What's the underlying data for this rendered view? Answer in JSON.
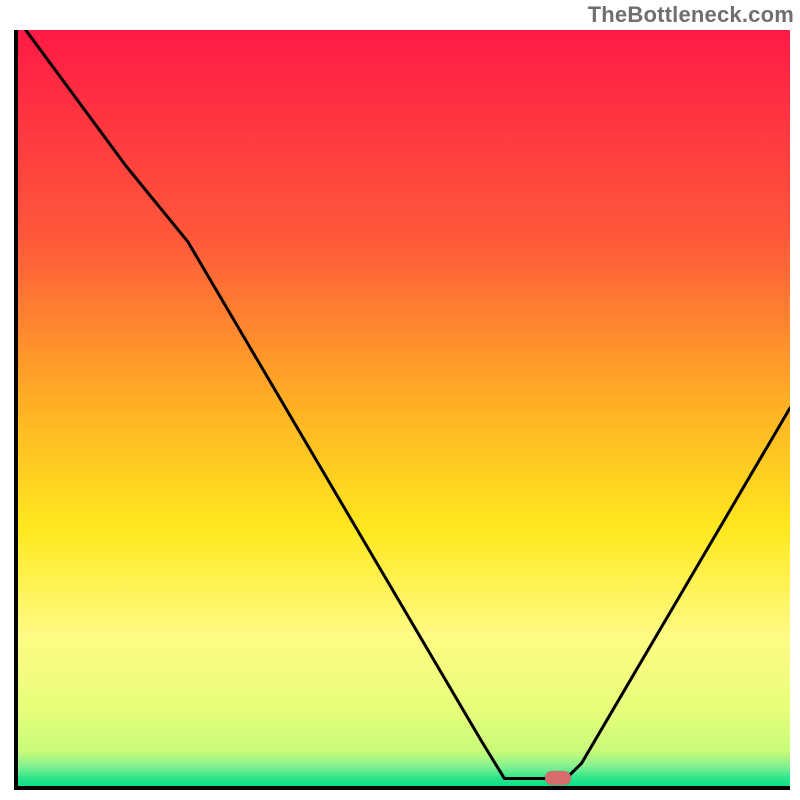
{
  "watermark": "TheBottleneck.com",
  "colors": {
    "gradient_stops": [
      {
        "offset": 0.0,
        "color": "#ff1a45"
      },
      {
        "offset": 0.28,
        "color": "#ff5a3a"
      },
      {
        "offset": 0.5,
        "color": "#ffb224"
      },
      {
        "offset": 0.66,
        "color": "#ffe81f"
      },
      {
        "offset": 0.8,
        "color": "#fffb84"
      },
      {
        "offset": 0.9,
        "color": "#e7fe7a"
      },
      {
        "offset": 0.955,
        "color": "#c7fb7a"
      },
      {
        "offset": 0.975,
        "color": "#7ff091"
      },
      {
        "offset": 0.99,
        "color": "#29e58b"
      },
      {
        "offset": 1.0,
        "color": "#11df86"
      }
    ],
    "marker": "#d86b6b",
    "curve": "#000000"
  },
  "chart_data": {
    "type": "line",
    "title": "",
    "xlabel": "",
    "ylabel": "",
    "xlim": [
      0,
      100
    ],
    "ylim": [
      0,
      100
    ],
    "series": [
      {
        "name": "bottleneck-curve",
        "points": [
          {
            "x": 1,
            "y": 100
          },
          {
            "x": 14,
            "y": 82
          },
          {
            "x": 22,
            "y": 72
          },
          {
            "x": 60,
            "y": 6
          },
          {
            "x": 63,
            "y": 1
          },
          {
            "x": 71,
            "y": 1
          },
          {
            "x": 73,
            "y": 3
          },
          {
            "x": 100,
            "y": 50
          }
        ]
      }
    ],
    "optimal_marker": {
      "x": 70,
      "y": 1
    },
    "grid": false,
    "legend": false
  }
}
